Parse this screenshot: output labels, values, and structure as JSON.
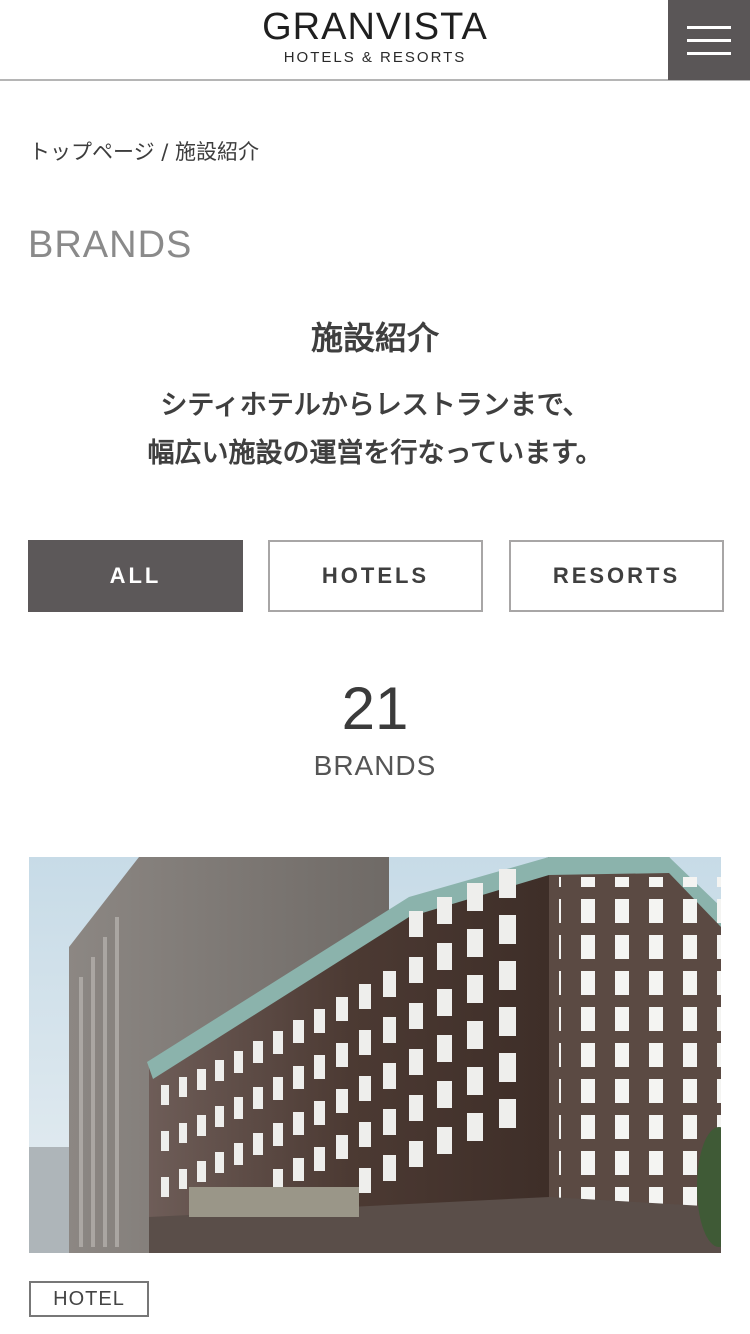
{
  "header": {
    "logo_main": "GRANVISTA",
    "logo_sub": "HOTELS & RESORTS",
    "menu_icon": "hamburger-menu-icon"
  },
  "breadcrumb": {
    "home": "トップページ",
    "separator": "/",
    "current": "施設紹介"
  },
  "section": {
    "title_en": "BRANDS",
    "title_jp": "施設紹介",
    "lead_line1": "シティホテルからレストランまで、",
    "lead_line2": "幅広い施設の運営を行なっています。"
  },
  "filters": [
    {
      "label": "ALL",
      "active": true
    },
    {
      "label": "HOTELS",
      "active": false
    },
    {
      "label": "RESORTS",
      "active": false
    }
  ],
  "count": {
    "number": "21",
    "label": "BRANDS"
  },
  "cards": [
    {
      "tag": "HOTEL",
      "image": "hotel-building-photo"
    }
  ],
  "colors": {
    "accent_dark": "#5c5859",
    "text": "#3f3f3f",
    "muted": "#8a8a8a",
    "border": "#a8a6a6"
  }
}
